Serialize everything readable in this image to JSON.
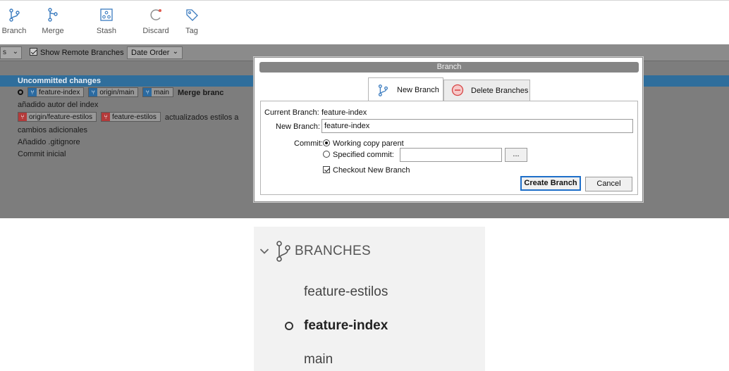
{
  "toolbar": {
    "items": [
      {
        "label": "Branch",
        "icon": "branch-icon"
      },
      {
        "label": "Merge",
        "icon": "merge-icon"
      },
      {
        "label": "Stash",
        "icon": "stash-icon"
      },
      {
        "label": "Discard",
        "icon": "discard-icon"
      },
      {
        "label": "Tag",
        "icon": "tag-icon"
      }
    ]
  },
  "filterbar": {
    "left_combo_text": "s",
    "show_remote_label": "Show Remote Branches",
    "show_remote_checked": true,
    "order_label": "Date Order"
  },
  "history": {
    "rows": [
      {
        "text": "Uncommitted changes"
      },
      {
        "tags": [
          "feature-index",
          "origin/main",
          "main"
        ],
        "message": "Merge branc"
      },
      {
        "text": "añadido autor del index"
      },
      {
        "tags": [
          "origin/feature-estilos",
          "feature-estilos"
        ],
        "message": "actualizados estilos a"
      },
      {
        "text": "cambios adicionales"
      },
      {
        "text": "Añadido .gitignore"
      },
      {
        "text": "Commit inicial"
      }
    ]
  },
  "dialog": {
    "title": "Branch",
    "tabs": {
      "new_branch": "New Branch",
      "delete_branches": "Delete Branches"
    },
    "current_branch_label": "Current Branch:",
    "current_branch_value": "feature-index",
    "new_branch_label": "New Branch:",
    "new_branch_value": "feature-index",
    "commit_label": "Commit:",
    "working_copy_label": "Working copy parent",
    "specified_commit_label": "Specified commit:",
    "specified_commit_value": "",
    "browse_label": "...",
    "checkout_label": "Checkout New Branch",
    "checkout_checked": true,
    "create_button": "Create Branch",
    "cancel_button": "Cancel"
  },
  "sidebar_zoom": {
    "header": "BRANCHES",
    "items": [
      "feature-estilos",
      "feature-index",
      "main"
    ],
    "current": "feature-index"
  },
  "colors": {
    "selection": "#2f6e9c",
    "local_branch_tag": "#2b6aa0",
    "remote_branch_tag": "#b33a3a",
    "default_button_border": "#1e6fc9"
  }
}
